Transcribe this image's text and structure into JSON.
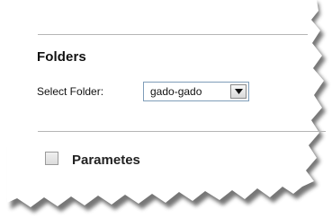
{
  "folders_section": {
    "title": "Folders",
    "select_label": "Select Folder:",
    "selected_folder": "gado-gado"
  },
  "parameters_section": {
    "label": "Parametes",
    "checked": false
  },
  "icons": {
    "dropdown": "chevron-down-icon"
  },
  "colors": {
    "divider": "#b5b5b5",
    "select_border": "#7f9db9",
    "text": "#111111"
  }
}
